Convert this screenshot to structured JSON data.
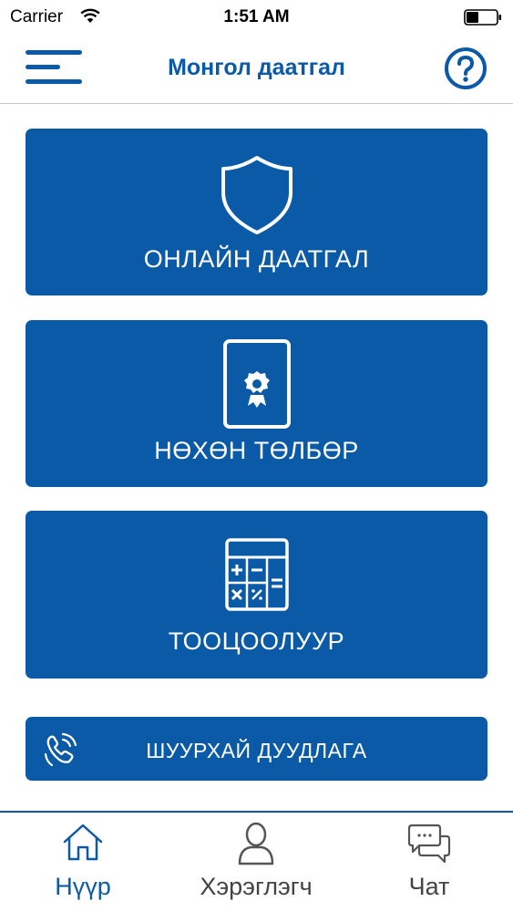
{
  "status_bar": {
    "carrier": "Carrier",
    "time": "1:51 AM",
    "icons": [
      "wifi-icon",
      "battery-icon"
    ]
  },
  "nav": {
    "title": "Монгол даатгал",
    "left_icon": "menu-icon",
    "right_icon": "help-icon"
  },
  "tiles": [
    {
      "label": "ОНЛАЙН ДААТГАЛ",
      "icon": "shield-icon"
    },
    {
      "label": "НӨХӨН ТӨЛБӨР",
      "icon": "certificate-card-icon"
    },
    {
      "label": "ТООЦООЛУУР",
      "icon": "calculator-icon"
    }
  ],
  "emergency": {
    "label": "ШУУРХАЙ ДУУДЛАГА",
    "icon": "phone-call-icon"
  },
  "tabs": [
    {
      "label": "Нүүр",
      "icon": "home-icon",
      "active": true
    },
    {
      "label": "Хэрэглэгч",
      "icon": "user-icon",
      "active": false
    },
    {
      "label": "Чат",
      "icon": "chat-icon",
      "active": false
    }
  ],
  "colors": {
    "primary": "#0b5aa8",
    "background": "#ffffff",
    "tab_inactive": "#444444"
  }
}
